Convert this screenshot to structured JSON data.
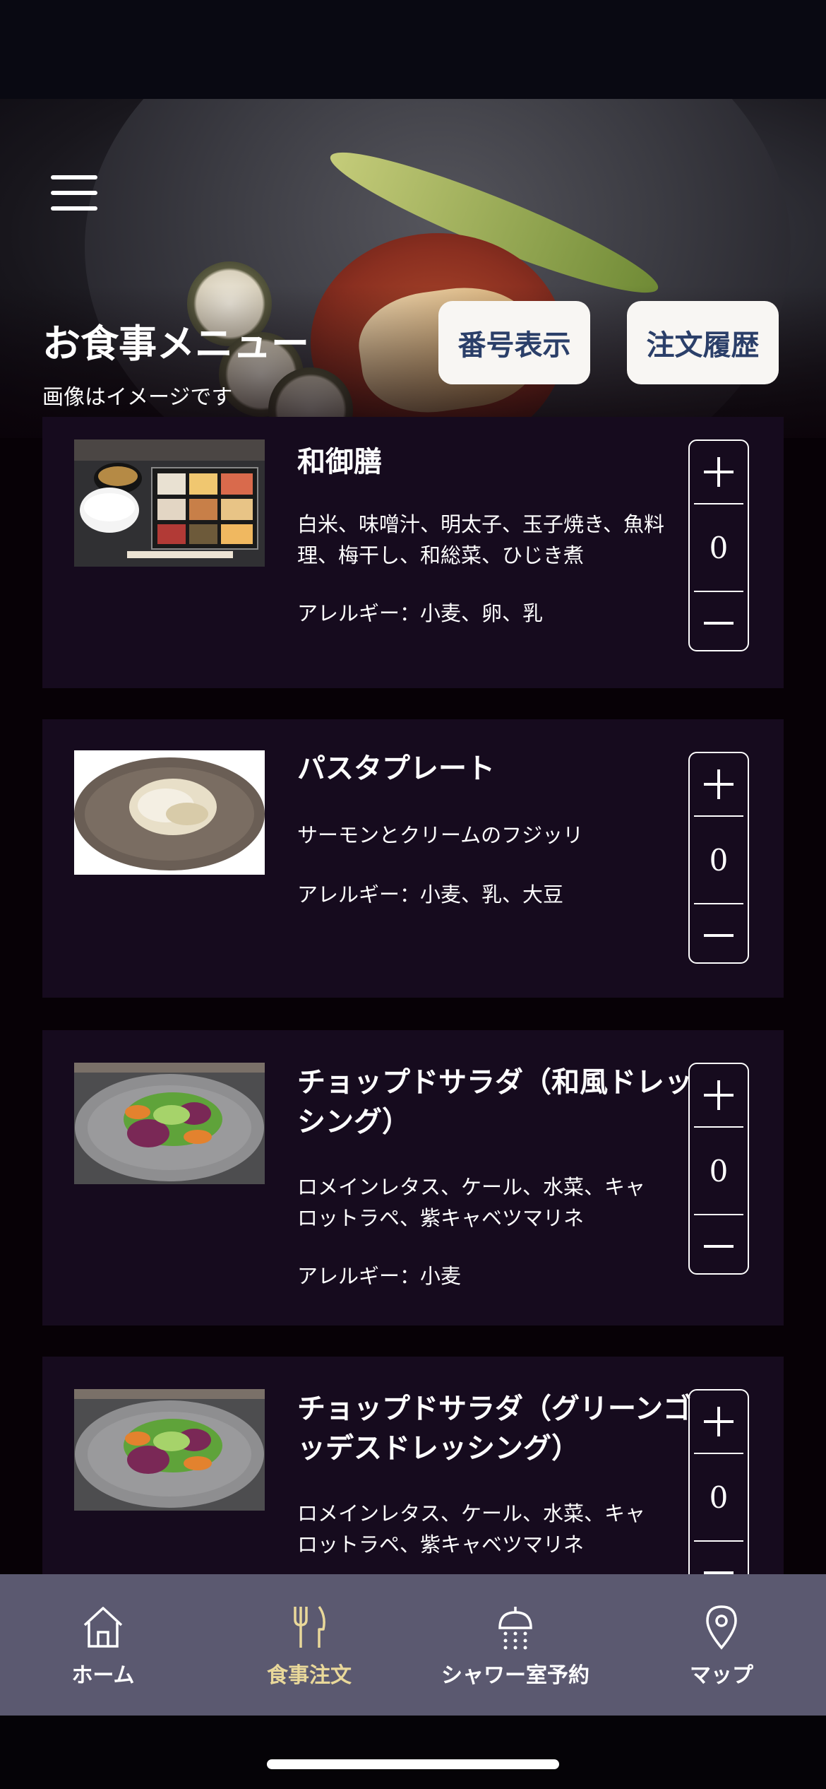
{
  "header": {
    "title": "お食事メニュー",
    "subtitle": "画像はイメージです",
    "number_button": "番号表示",
    "history_button": "注文履歴"
  },
  "menu_items": [
    {
      "name": "和御膳",
      "description": "白米、味噌汁、明太子、玉子焼き、魚料理、梅干し、和総菜、ひじき煮",
      "allergy": "アレルギー：小麦、卵、乳",
      "quantity": "0"
    },
    {
      "name": "パスタプレート",
      "description": "サーモンとクリームのフジッリ",
      "allergy": "アレルギー：小麦、乳、大豆",
      "quantity": "0"
    },
    {
      "name": "チョップドサラダ（和風ドレッシング）",
      "description": "ロメインレタス、ケール、水菜、キャロットラペ、紫キャベツマリネ",
      "allergy": "アレルギー：小麦",
      "quantity": "0"
    },
    {
      "name": "チョップドサラダ（グリーンゴッデスドレッシング）",
      "description": "ロメインレタス、ケール、水菜、キャロットラペ、紫キャベツマリネ",
      "allergy": "",
      "quantity": "0"
    }
  ],
  "tabs": [
    {
      "label": "ホーム",
      "icon": "home-icon"
    },
    {
      "label": "食事注文",
      "icon": "fork-knife-icon"
    },
    {
      "label": "シャワー室予約",
      "icon": "shower-icon"
    },
    {
      "label": "マップ",
      "icon": "map-pin-icon"
    }
  ],
  "colors": {
    "card_background": "#160b1e",
    "tabbar_background": "#5b5970",
    "active_tab": "#e9d89a",
    "button_text": "#2b3f69"
  }
}
